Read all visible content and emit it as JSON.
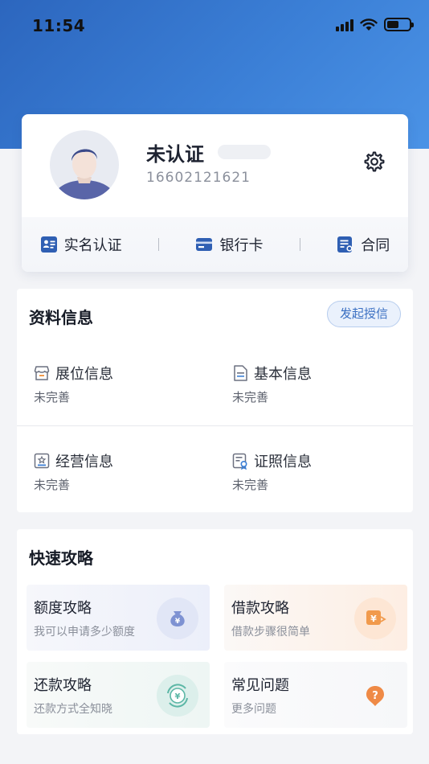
{
  "status_bar": {
    "time": "11:54"
  },
  "profile": {
    "name": "未认证",
    "phone": "16602121621",
    "actions": [
      {
        "label": "实名认证",
        "icon": "id-card-icon"
      },
      {
        "label": "银行卡",
        "icon": "bank-card-icon"
      },
      {
        "label": "合同",
        "icon": "contract-icon"
      }
    ]
  },
  "info_section": {
    "title": "资料信息",
    "apply_label": "发起授信",
    "items": [
      {
        "label": "展位信息",
        "status": "未完善",
        "icon": "booth-icon"
      },
      {
        "label": "基本信息",
        "status": "未完善",
        "icon": "document-icon"
      },
      {
        "label": "经营信息",
        "status": "未完善",
        "icon": "business-icon"
      },
      {
        "label": "证照信息",
        "status": "未完善",
        "icon": "license-icon"
      }
    ]
  },
  "guide_section": {
    "title": "快速攻略",
    "items": [
      {
        "title": "额度攻略",
        "subtitle": "我可以申请多少额度",
        "icon": "money-bag-icon"
      },
      {
        "title": "借款攻略",
        "subtitle": "借款步骤很简单",
        "icon": "yen-card-icon"
      },
      {
        "title": "还款攻略",
        "subtitle": "还款方式全知晓",
        "icon": "yen-cycle-icon"
      },
      {
        "title": "常见问题",
        "subtitle": "更多问题",
        "icon": "question-icon"
      }
    ]
  },
  "colors": {
    "primary": "#3b7fd6",
    "accent_orange": "#f19a4c",
    "accent_green": "#5cb7a6"
  }
}
